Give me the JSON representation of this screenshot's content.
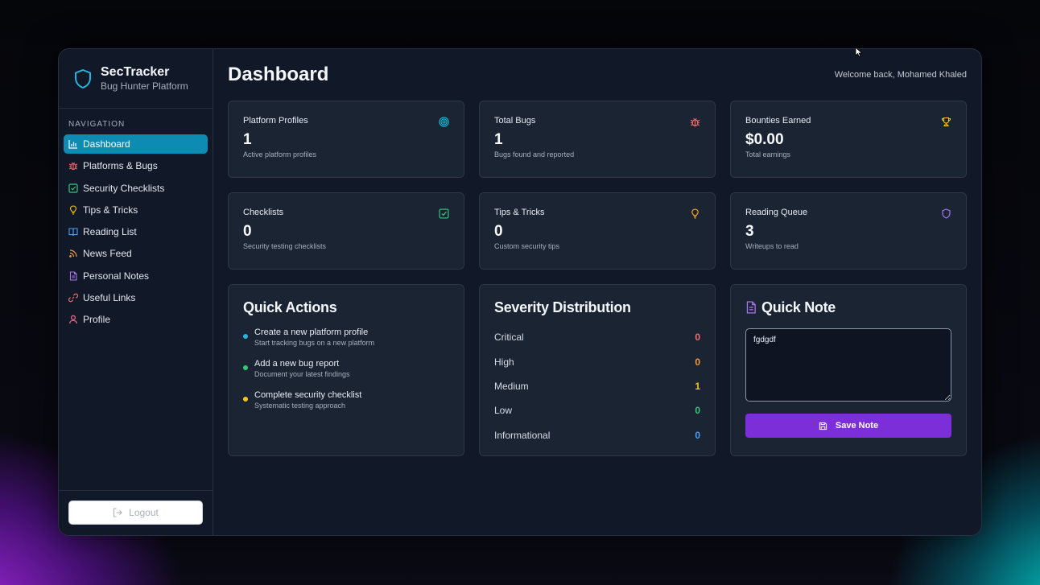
{
  "brand": {
    "title": "SecTracker",
    "subtitle": "Bug Hunter Platform"
  },
  "sidebar": {
    "section_label": "NAVIGATION",
    "items": [
      {
        "label": "Dashboard",
        "icon": "bar-chart-icon",
        "active": true
      },
      {
        "label": "Platforms & Bugs",
        "icon": "bug-icon"
      },
      {
        "label": "Security Checklists",
        "icon": "checkbox-icon"
      },
      {
        "label": "Tips & Tricks",
        "icon": "lightbulb-icon"
      },
      {
        "label": "Reading List",
        "icon": "book-icon"
      },
      {
        "label": "News Feed",
        "icon": "rss-icon"
      },
      {
        "label": "Personal Notes",
        "icon": "document-icon"
      },
      {
        "label": "Useful Links",
        "icon": "link-icon"
      },
      {
        "label": "Profile",
        "icon": "user-icon"
      }
    ],
    "logout_label": "Logout"
  },
  "header": {
    "title": "Dashboard",
    "welcome": "Welcome back, Mohamed Khaled"
  },
  "stats": [
    {
      "title": "Platform Profiles",
      "value": "1",
      "desc": "Active platform profiles",
      "icon": "target-icon",
      "color": "#22b8e0"
    },
    {
      "title": "Total Bugs",
      "value": "1",
      "desc": "Bugs found and reported",
      "icon": "bug-icon",
      "color": "#f26d6d"
    },
    {
      "title": "Bounties Earned",
      "value": "$0.00",
      "desc": "Total earnings",
      "icon": "trophy-icon",
      "color": "#f5c518"
    },
    {
      "title": "Checklists",
      "value": "0",
      "desc": "Security testing checklists",
      "icon": "checkbox-icon",
      "color": "#34c77b"
    },
    {
      "title": "Tips & Tricks",
      "value": "0",
      "desc": "Custom security tips",
      "icon": "lightbulb-icon",
      "color": "#f5a623"
    },
    {
      "title": "Reading Queue",
      "value": "3",
      "desc": "Writeups to read",
      "icon": "shield-icon",
      "color": "#a974f0"
    }
  ],
  "quick_actions": {
    "title": "Quick Actions",
    "items": [
      {
        "title": "Create a new platform profile",
        "sub": "Start tracking bugs on a new platform",
        "color": "#22b8e0"
      },
      {
        "title": "Add a new bug report",
        "sub": "Document your latest findings",
        "color": "#34c77b"
      },
      {
        "title": "Complete security checklist",
        "sub": "Systematic testing approach",
        "color": "#f5c518"
      }
    ]
  },
  "severity": {
    "title": "Severity Distribution",
    "rows": [
      {
        "label": "Critical",
        "count": "0",
        "color": "#f26d6d"
      },
      {
        "label": "High",
        "count": "0",
        "color": "#f59a3c"
      },
      {
        "label": "Medium",
        "count": "1",
        "color": "#f5c518"
      },
      {
        "label": "Low",
        "count": "0",
        "color": "#34c77b"
      },
      {
        "label": "Informational",
        "count": "0",
        "color": "#4a9ff5"
      }
    ]
  },
  "quick_note": {
    "title": "Quick Note",
    "value": "fgdgdf",
    "save_label": "Save Note"
  },
  "colors": {
    "accent": "#0e8bb3",
    "save_button": "#7c2fd9",
    "panel": "#1b2433",
    "window": "#111827"
  }
}
